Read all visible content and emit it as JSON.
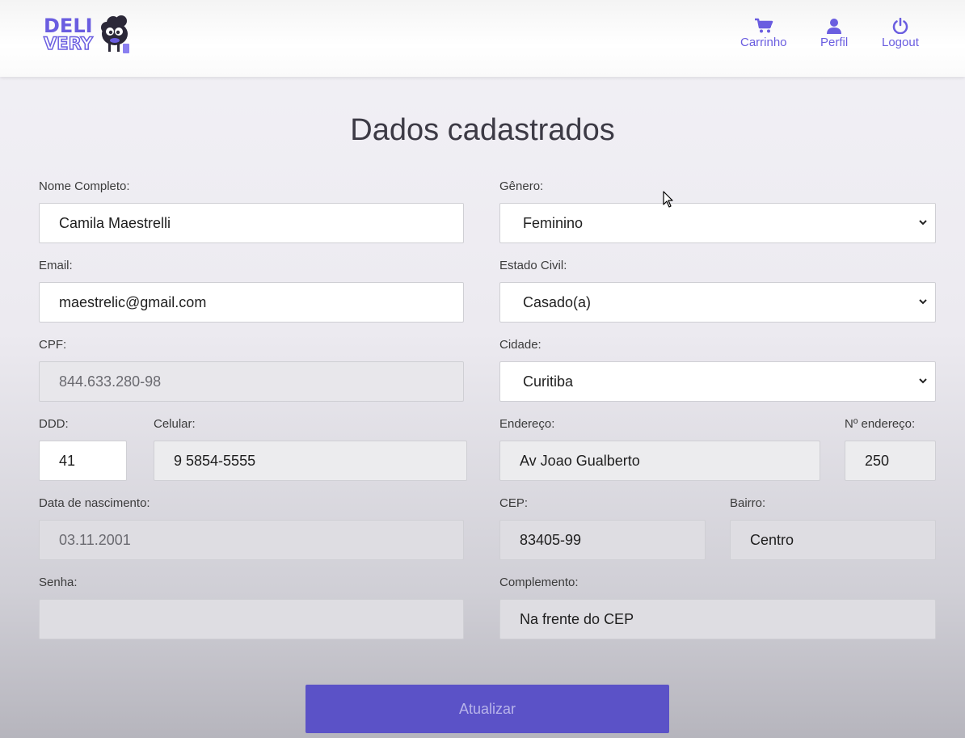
{
  "brand": {
    "line1": "DELI",
    "line2": "VERY"
  },
  "nav": {
    "cart": "Carrinho",
    "profile": "Perfil",
    "logout": "Logout"
  },
  "title": "Dados cadastrados",
  "form": {
    "nome": {
      "label": "Nome Completo:",
      "value": "Camila Maestrelli"
    },
    "email": {
      "label": "Email:",
      "value": "maestrelic@gmail.com"
    },
    "cpf": {
      "label": "CPF:",
      "value": "844.633.280-98"
    },
    "ddd": {
      "label": "DDD:",
      "value": "41"
    },
    "celular": {
      "label": "Celular:",
      "value": "9 5854-5555"
    },
    "nascimento": {
      "label": "Data de nascimento:",
      "value": "03.11.2001"
    },
    "senha": {
      "label": "Senha:",
      "value": ""
    },
    "genero": {
      "label": "Gênero:",
      "value": "Feminino"
    },
    "estado_civil": {
      "label": "Estado Civil:",
      "value": "Casado(a)"
    },
    "cidade": {
      "label": "Cidade:",
      "value": "Curitiba"
    },
    "endereco": {
      "label": "Endereço:",
      "value": "Av Joao Gualberto"
    },
    "numero": {
      "label": "Nº endereço:",
      "value": "250"
    },
    "cep": {
      "label": "CEP:",
      "value": "83405-99"
    },
    "bairro": {
      "label": "Bairro:",
      "value": "Centro"
    },
    "complemento": {
      "label": "Complemento:",
      "value": "Na frente do CEP"
    }
  },
  "submit_label": "Atualizar",
  "colors": {
    "accent": "#6a5de0",
    "button": "#5b52c7"
  }
}
